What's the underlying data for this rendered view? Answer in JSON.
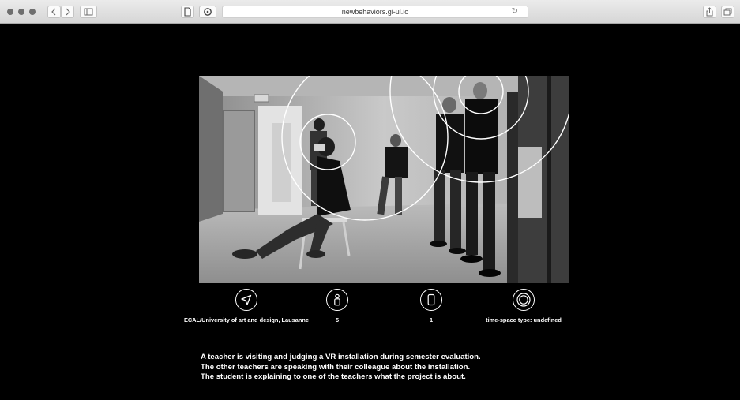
{
  "browser": {
    "url": "newbehaviors.gi-ul.io"
  },
  "meta": [
    {
      "icon": "location-arrow-icon",
      "text": "ECAL/University of art and design, Lausanne"
    },
    {
      "icon": "person-icon",
      "text": "5"
    },
    {
      "icon": "phone-icon",
      "text": "1"
    },
    {
      "icon": "concentric-circles-icon",
      "text": "time-space type: undefined"
    }
  ],
  "description": [
    "A teacher is visiting and judging a VR installation during semester evaluation.",
    "The other teachers are speaking with their colleague about the installation.",
    "The student is explaining to one of the teachers what the project is about."
  ]
}
